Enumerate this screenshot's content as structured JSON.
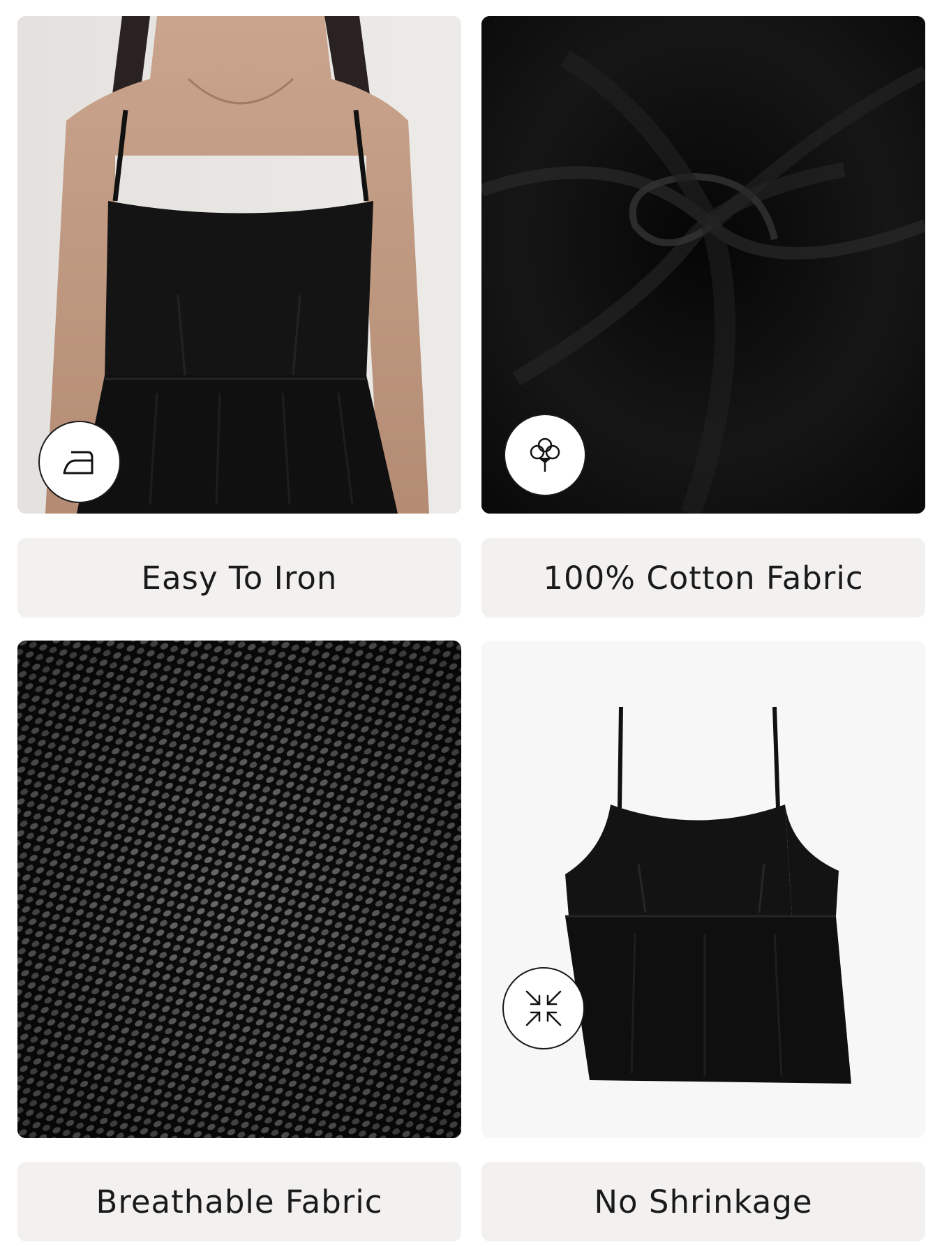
{
  "features": [
    {
      "label": "Easy To Iron",
      "icon": "iron-icon"
    },
    {
      "label": "100% Cotton Fabric",
      "icon": "cotton-flower-icon"
    },
    {
      "label": "Breathable Fabric",
      "icon": ""
    },
    {
      "label": "No Shrinkage",
      "icon": "shrink-arrows-icon"
    }
  ],
  "colors": {
    "label_bg": "#f2f1ef",
    "text": "#1a1a1a",
    "garment": "#121212",
    "fabric": "#0e0e0e"
  }
}
